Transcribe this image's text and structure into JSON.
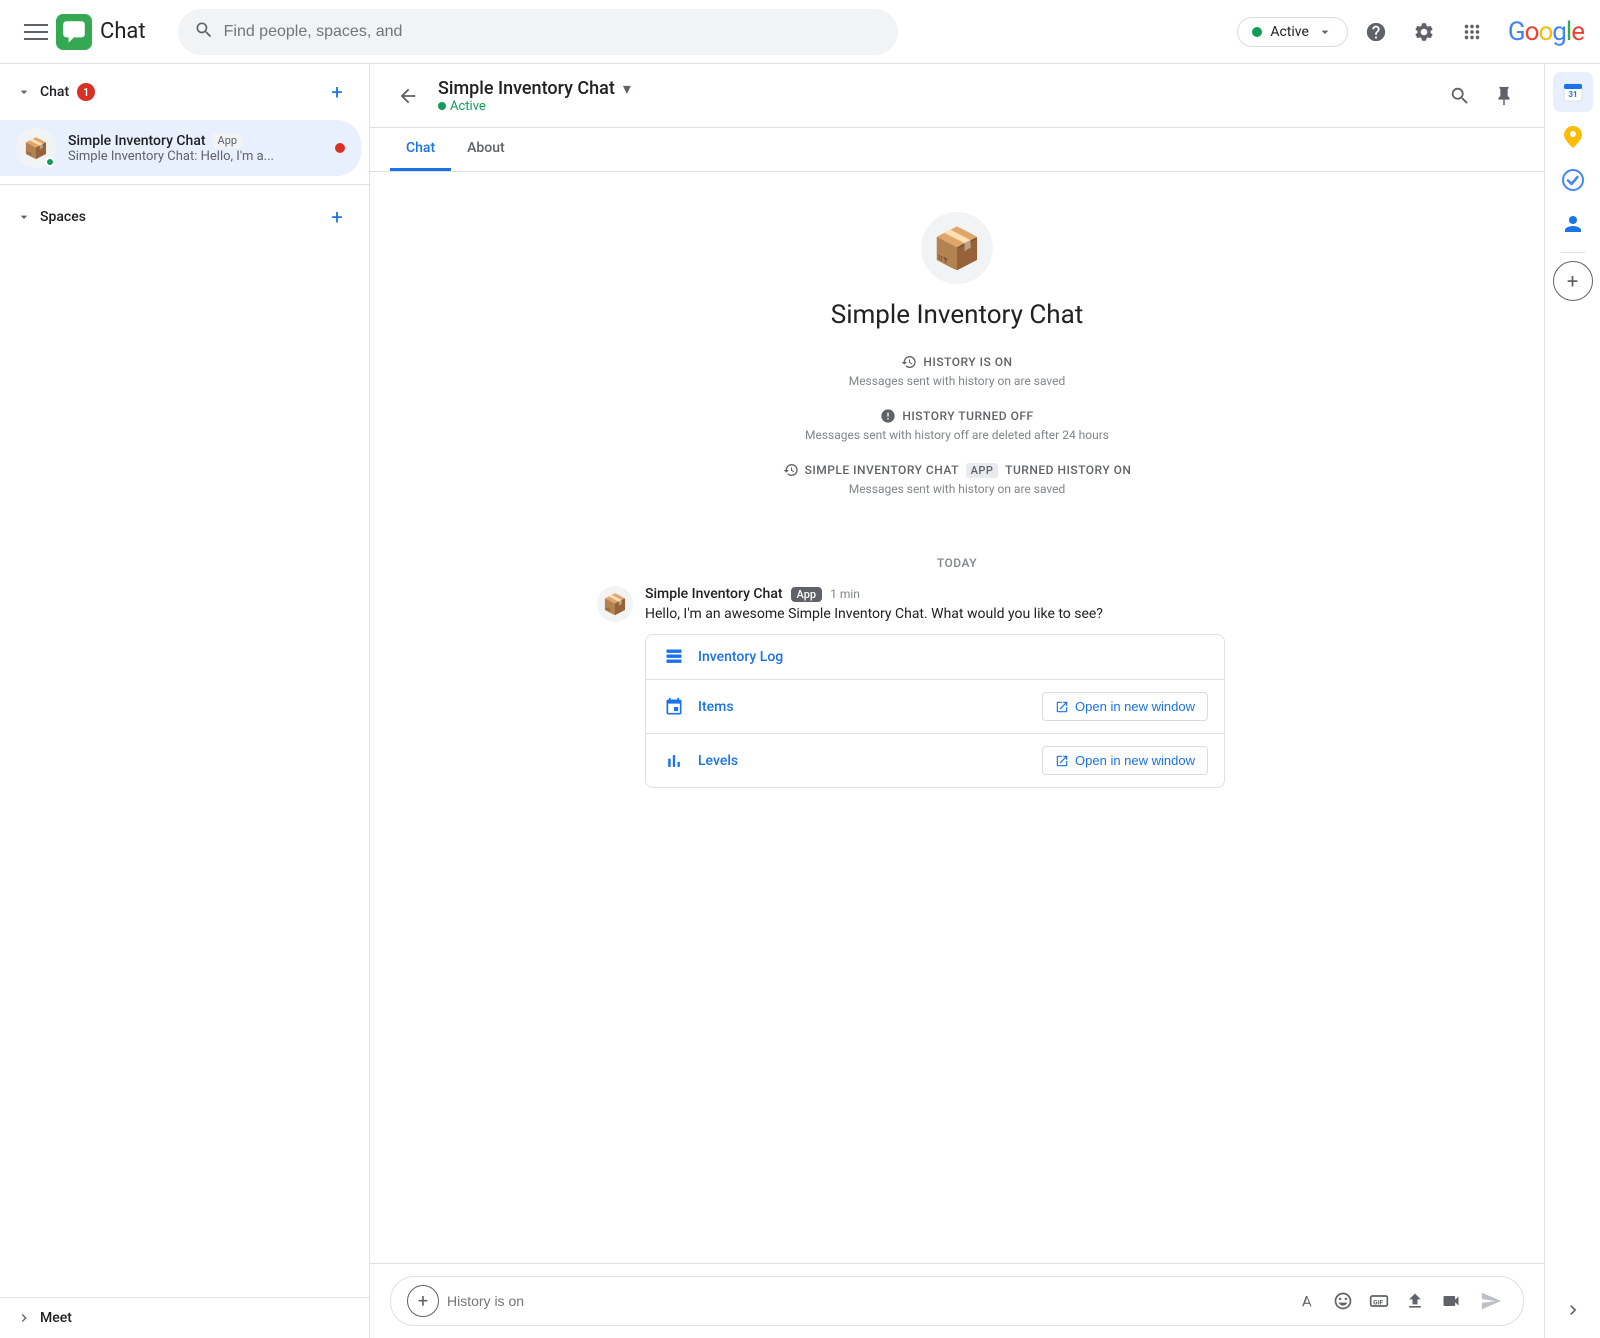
{
  "topnav": {
    "app_name": "Chat",
    "search_placeholder": "Find people, spaces, and",
    "active_label": "Active",
    "google_label": "Google"
  },
  "sidebar": {
    "chat_section": "Chat",
    "chat_badge": "1",
    "chat_item": {
      "name": "Simple Inventory Chat",
      "app_label": "App",
      "preview": "Simple Inventory Chat: Hello, I'm a..."
    },
    "spaces_section": "Spaces",
    "meet_section": "Meet"
  },
  "chat_header": {
    "title": "Simple Inventory Chat",
    "status": "Active"
  },
  "tabs": {
    "chat": "Chat",
    "about": "About"
  },
  "bot_section": {
    "name": "Simple Inventory Chat",
    "history_on_label": "HISTORY IS ON",
    "history_on_sub": "Messages sent with history on are saved",
    "history_off_label": "HISTORY TURNED OFF",
    "history_off_sub": "Messages sent with history off are deleted after 24 hours",
    "history_on2_label": "SIMPLE INVENTORY CHAT",
    "history_on2_app": "APP",
    "history_on2_action": "TURNED HISTORY ON",
    "history_on2_sub": "Messages sent with history on are saved",
    "today_label": "TODAY"
  },
  "message": {
    "sender": "Simple Inventory Chat",
    "app_label": "App",
    "time": "1 min",
    "text": "Hello, I'm an awesome  Simple Inventory Chat. What would you like to see?"
  },
  "card": {
    "items": [
      {
        "label": "Inventory Log",
        "show_open": false
      },
      {
        "label": "Items",
        "show_open": true,
        "open_label": "Open in new window"
      },
      {
        "label": "Levels",
        "show_open": true,
        "open_label": "Open in new window"
      }
    ]
  },
  "input": {
    "placeholder": "History is on"
  }
}
